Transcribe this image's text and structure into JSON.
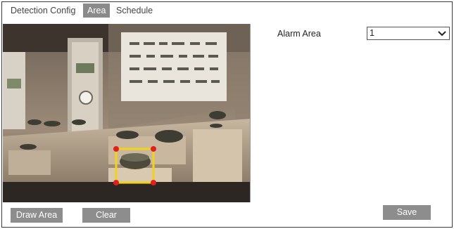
{
  "tabs": [
    {
      "label": "Detection Config",
      "active": false
    },
    {
      "label": "Area",
      "active": true
    },
    {
      "label": "Schedule",
      "active": false
    }
  ],
  "alarm_area": {
    "label": "Alarm Area",
    "selected": "1"
  },
  "buttons": {
    "draw_area": "Draw Area",
    "clear": "Clear",
    "save": "Save"
  },
  "colors": {
    "tab_active_bg": "#8a8a8a",
    "button_bg": "#8d8d8d",
    "area_outline": "#f2d21a",
    "area_handle": "#e02020"
  },
  "icons": {
    "select_arrow": "chevron-down-icon"
  }
}
